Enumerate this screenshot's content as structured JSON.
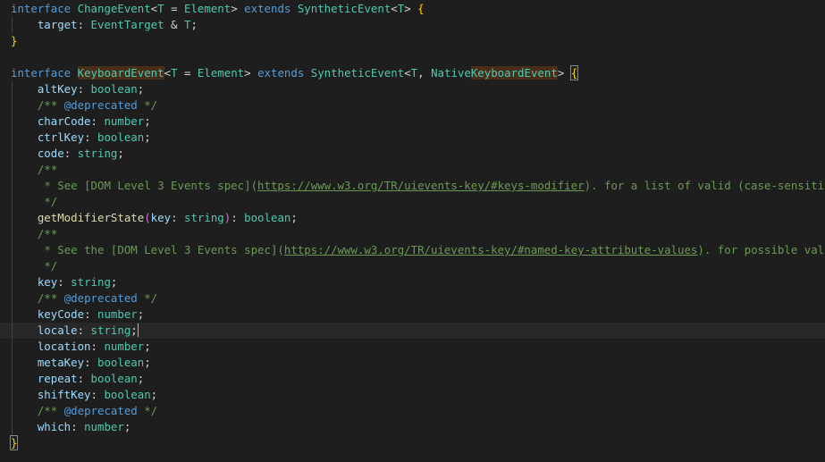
{
  "editor": {
    "lines": [
      [
        {
          "t": "interface",
          "c": "kw"
        },
        {
          "t": " "
        },
        {
          "t": "ChangeEvent",
          "c": "type"
        },
        {
          "t": "<",
          "c": "pun"
        },
        {
          "t": "T",
          "c": "type"
        },
        {
          "t": " = ",
          "c": "op"
        },
        {
          "t": "Element",
          "c": "type"
        },
        {
          "t": ">",
          "c": "pun"
        },
        {
          "t": " "
        },
        {
          "t": "extends",
          "c": "kw"
        },
        {
          "t": " "
        },
        {
          "t": "SyntheticEvent",
          "c": "type"
        },
        {
          "t": "<",
          "c": "pun"
        },
        {
          "t": "T",
          "c": "type"
        },
        {
          "t": ">",
          "c": "pun"
        },
        {
          "t": " "
        },
        {
          "t": "{",
          "c": "br1"
        }
      ],
      [
        {
          "t": "    "
        },
        {
          "t": "target",
          "c": "prop"
        },
        {
          "t": ": ",
          "c": "pun"
        },
        {
          "t": "EventTarget",
          "c": "type"
        },
        {
          "t": " & ",
          "c": "op"
        },
        {
          "t": "T",
          "c": "type"
        },
        {
          "t": ";",
          "c": "pun"
        }
      ],
      [
        {
          "t": "}",
          "c": "br1"
        }
      ],
      [],
      [
        {
          "t": "interface",
          "c": "kw"
        },
        {
          "t": " "
        },
        {
          "t": "KeyboardEvent",
          "c": "type",
          "hl": true
        },
        {
          "t": "<",
          "c": "pun"
        },
        {
          "t": "T",
          "c": "type"
        },
        {
          "t": " = ",
          "c": "op"
        },
        {
          "t": "Element",
          "c": "type"
        },
        {
          "t": ">",
          "c": "pun"
        },
        {
          "t": " "
        },
        {
          "t": "extends",
          "c": "kw"
        },
        {
          "t": " "
        },
        {
          "t": "SyntheticEvent",
          "c": "type"
        },
        {
          "t": "<",
          "c": "pun"
        },
        {
          "t": "T",
          "c": "type"
        },
        {
          "t": ", ",
          "c": "pun"
        },
        {
          "t": "Native",
          "c": "type"
        },
        {
          "t": "KeyboardEvent",
          "c": "type",
          "hl": true
        },
        {
          "t": ">",
          "c": "pun"
        },
        {
          "t": " "
        },
        {
          "t": "{",
          "c": "br1",
          "box": true
        }
      ],
      [
        {
          "t": "    "
        },
        {
          "t": "altKey",
          "c": "prop"
        },
        {
          "t": ": ",
          "c": "pun"
        },
        {
          "t": "boolean",
          "c": "type"
        },
        {
          "t": ";",
          "c": "pun"
        }
      ],
      [
        {
          "t": "    "
        },
        {
          "t": "/** ",
          "c": "cmt"
        },
        {
          "t": "@deprecated",
          "c": "tag"
        },
        {
          "t": " */",
          "c": "cmt"
        }
      ],
      [
        {
          "t": "    "
        },
        {
          "t": "charCode",
          "c": "prop"
        },
        {
          "t": ": ",
          "c": "pun"
        },
        {
          "t": "number",
          "c": "type"
        },
        {
          "t": ";",
          "c": "pun"
        }
      ],
      [
        {
          "t": "    "
        },
        {
          "t": "ctrlKey",
          "c": "prop"
        },
        {
          "t": ": ",
          "c": "pun"
        },
        {
          "t": "boolean",
          "c": "type"
        },
        {
          "t": ";",
          "c": "pun"
        }
      ],
      [
        {
          "t": "    "
        },
        {
          "t": "code",
          "c": "prop"
        },
        {
          "t": ": ",
          "c": "pun"
        },
        {
          "t": "string",
          "c": "type"
        },
        {
          "t": ";",
          "c": "pun"
        }
      ],
      [
        {
          "t": "    "
        },
        {
          "t": "/**",
          "c": "cmt"
        }
      ],
      [
        {
          "t": "     "
        },
        {
          "t": "* See [DOM Level 3 Events spec](",
          "c": "cmt"
        },
        {
          "t": "https://www.w3.org/TR/uievents-key/#keys-modifier",
          "c": "link"
        },
        {
          "t": "). for a list of valid (case-sensitive) arguments to this method.",
          "c": "cmt"
        }
      ],
      [
        {
          "t": "     "
        },
        {
          "t": "*/",
          "c": "cmt"
        }
      ],
      [
        {
          "t": "    "
        },
        {
          "t": "getModifierState",
          "c": "fn"
        },
        {
          "t": "(",
          "c": "br2"
        },
        {
          "t": "key",
          "c": "prop"
        },
        {
          "t": ": ",
          "c": "pun"
        },
        {
          "t": "string",
          "c": "type"
        },
        {
          "t": ")",
          "c": "br2"
        },
        {
          "t": ": ",
          "c": "pun"
        },
        {
          "t": "boolean",
          "c": "type"
        },
        {
          "t": ";",
          "c": "pun"
        }
      ],
      [
        {
          "t": "    "
        },
        {
          "t": "/**",
          "c": "cmt"
        }
      ],
      [
        {
          "t": "     "
        },
        {
          "t": "* See the [DOM Level 3 Events spec](",
          "c": "cmt"
        },
        {
          "t": "https://www.w3.org/TR/uievents-key/#named-key-attribute-values",
          "c": "link"
        },
        {
          "t": "). for possible values",
          "c": "cmt"
        }
      ],
      [
        {
          "t": "     "
        },
        {
          "t": "*/",
          "c": "cmt"
        }
      ],
      [
        {
          "t": "    "
        },
        {
          "t": "key",
          "c": "prop"
        },
        {
          "t": ": ",
          "c": "pun"
        },
        {
          "t": "string",
          "c": "type"
        },
        {
          "t": ";",
          "c": "pun"
        }
      ],
      [
        {
          "t": "    "
        },
        {
          "t": "/** ",
          "c": "cmt"
        },
        {
          "t": "@deprecated",
          "c": "tag"
        },
        {
          "t": " */",
          "c": "cmt"
        }
      ],
      [
        {
          "t": "    "
        },
        {
          "t": "keyCode",
          "c": "prop"
        },
        {
          "t": ": ",
          "c": "pun"
        },
        {
          "t": "number",
          "c": "type"
        },
        {
          "t": ";",
          "c": "pun"
        }
      ],
      [
        {
          "t": "    "
        },
        {
          "t": "locale",
          "c": "prop"
        },
        {
          "t": ": ",
          "c": "pun"
        },
        {
          "t": "string",
          "c": "type"
        },
        {
          "t": ";",
          "c": "pun"
        },
        {
          "cursor": true
        }
      ],
      [
        {
          "t": "    "
        },
        {
          "t": "location",
          "c": "prop"
        },
        {
          "t": ": ",
          "c": "pun"
        },
        {
          "t": "number",
          "c": "type"
        },
        {
          "t": ";",
          "c": "pun"
        }
      ],
      [
        {
          "t": "    "
        },
        {
          "t": "metaKey",
          "c": "prop"
        },
        {
          "t": ": ",
          "c": "pun"
        },
        {
          "t": "boolean",
          "c": "type"
        },
        {
          "t": ";",
          "c": "pun"
        }
      ],
      [
        {
          "t": "    "
        },
        {
          "t": "repeat",
          "c": "prop"
        },
        {
          "t": ": ",
          "c": "pun"
        },
        {
          "t": "boolean",
          "c": "type"
        },
        {
          "t": ";",
          "c": "pun"
        }
      ],
      [
        {
          "t": "    "
        },
        {
          "t": "shiftKey",
          "c": "prop"
        },
        {
          "t": ": ",
          "c": "pun"
        },
        {
          "t": "boolean",
          "c": "type"
        },
        {
          "t": ";",
          "c": "pun"
        }
      ],
      [
        {
          "t": "    "
        },
        {
          "t": "/** ",
          "c": "cmt"
        },
        {
          "t": "@deprecated",
          "c": "tag"
        },
        {
          "t": " */",
          "c": "cmt"
        }
      ],
      [
        {
          "t": "    "
        },
        {
          "t": "which",
          "c": "prop"
        },
        {
          "t": ": ",
          "c": "pun"
        },
        {
          "t": "number",
          "c": "type"
        },
        {
          "t": ";",
          "c": "pun"
        }
      ],
      [
        {
          "t": "}",
          "c": "br1",
          "box": true
        }
      ]
    ],
    "current_line": 20,
    "colors": {
      "background": "#1e1e1e",
      "keyword": "#569cd6",
      "type": "#4ec9b0",
      "property": "#9cdcfe",
      "function": "#dcdcaa",
      "comment": "#6a9955",
      "bracket": "#ffd700",
      "word_highlight": "#4a2d18"
    }
  }
}
